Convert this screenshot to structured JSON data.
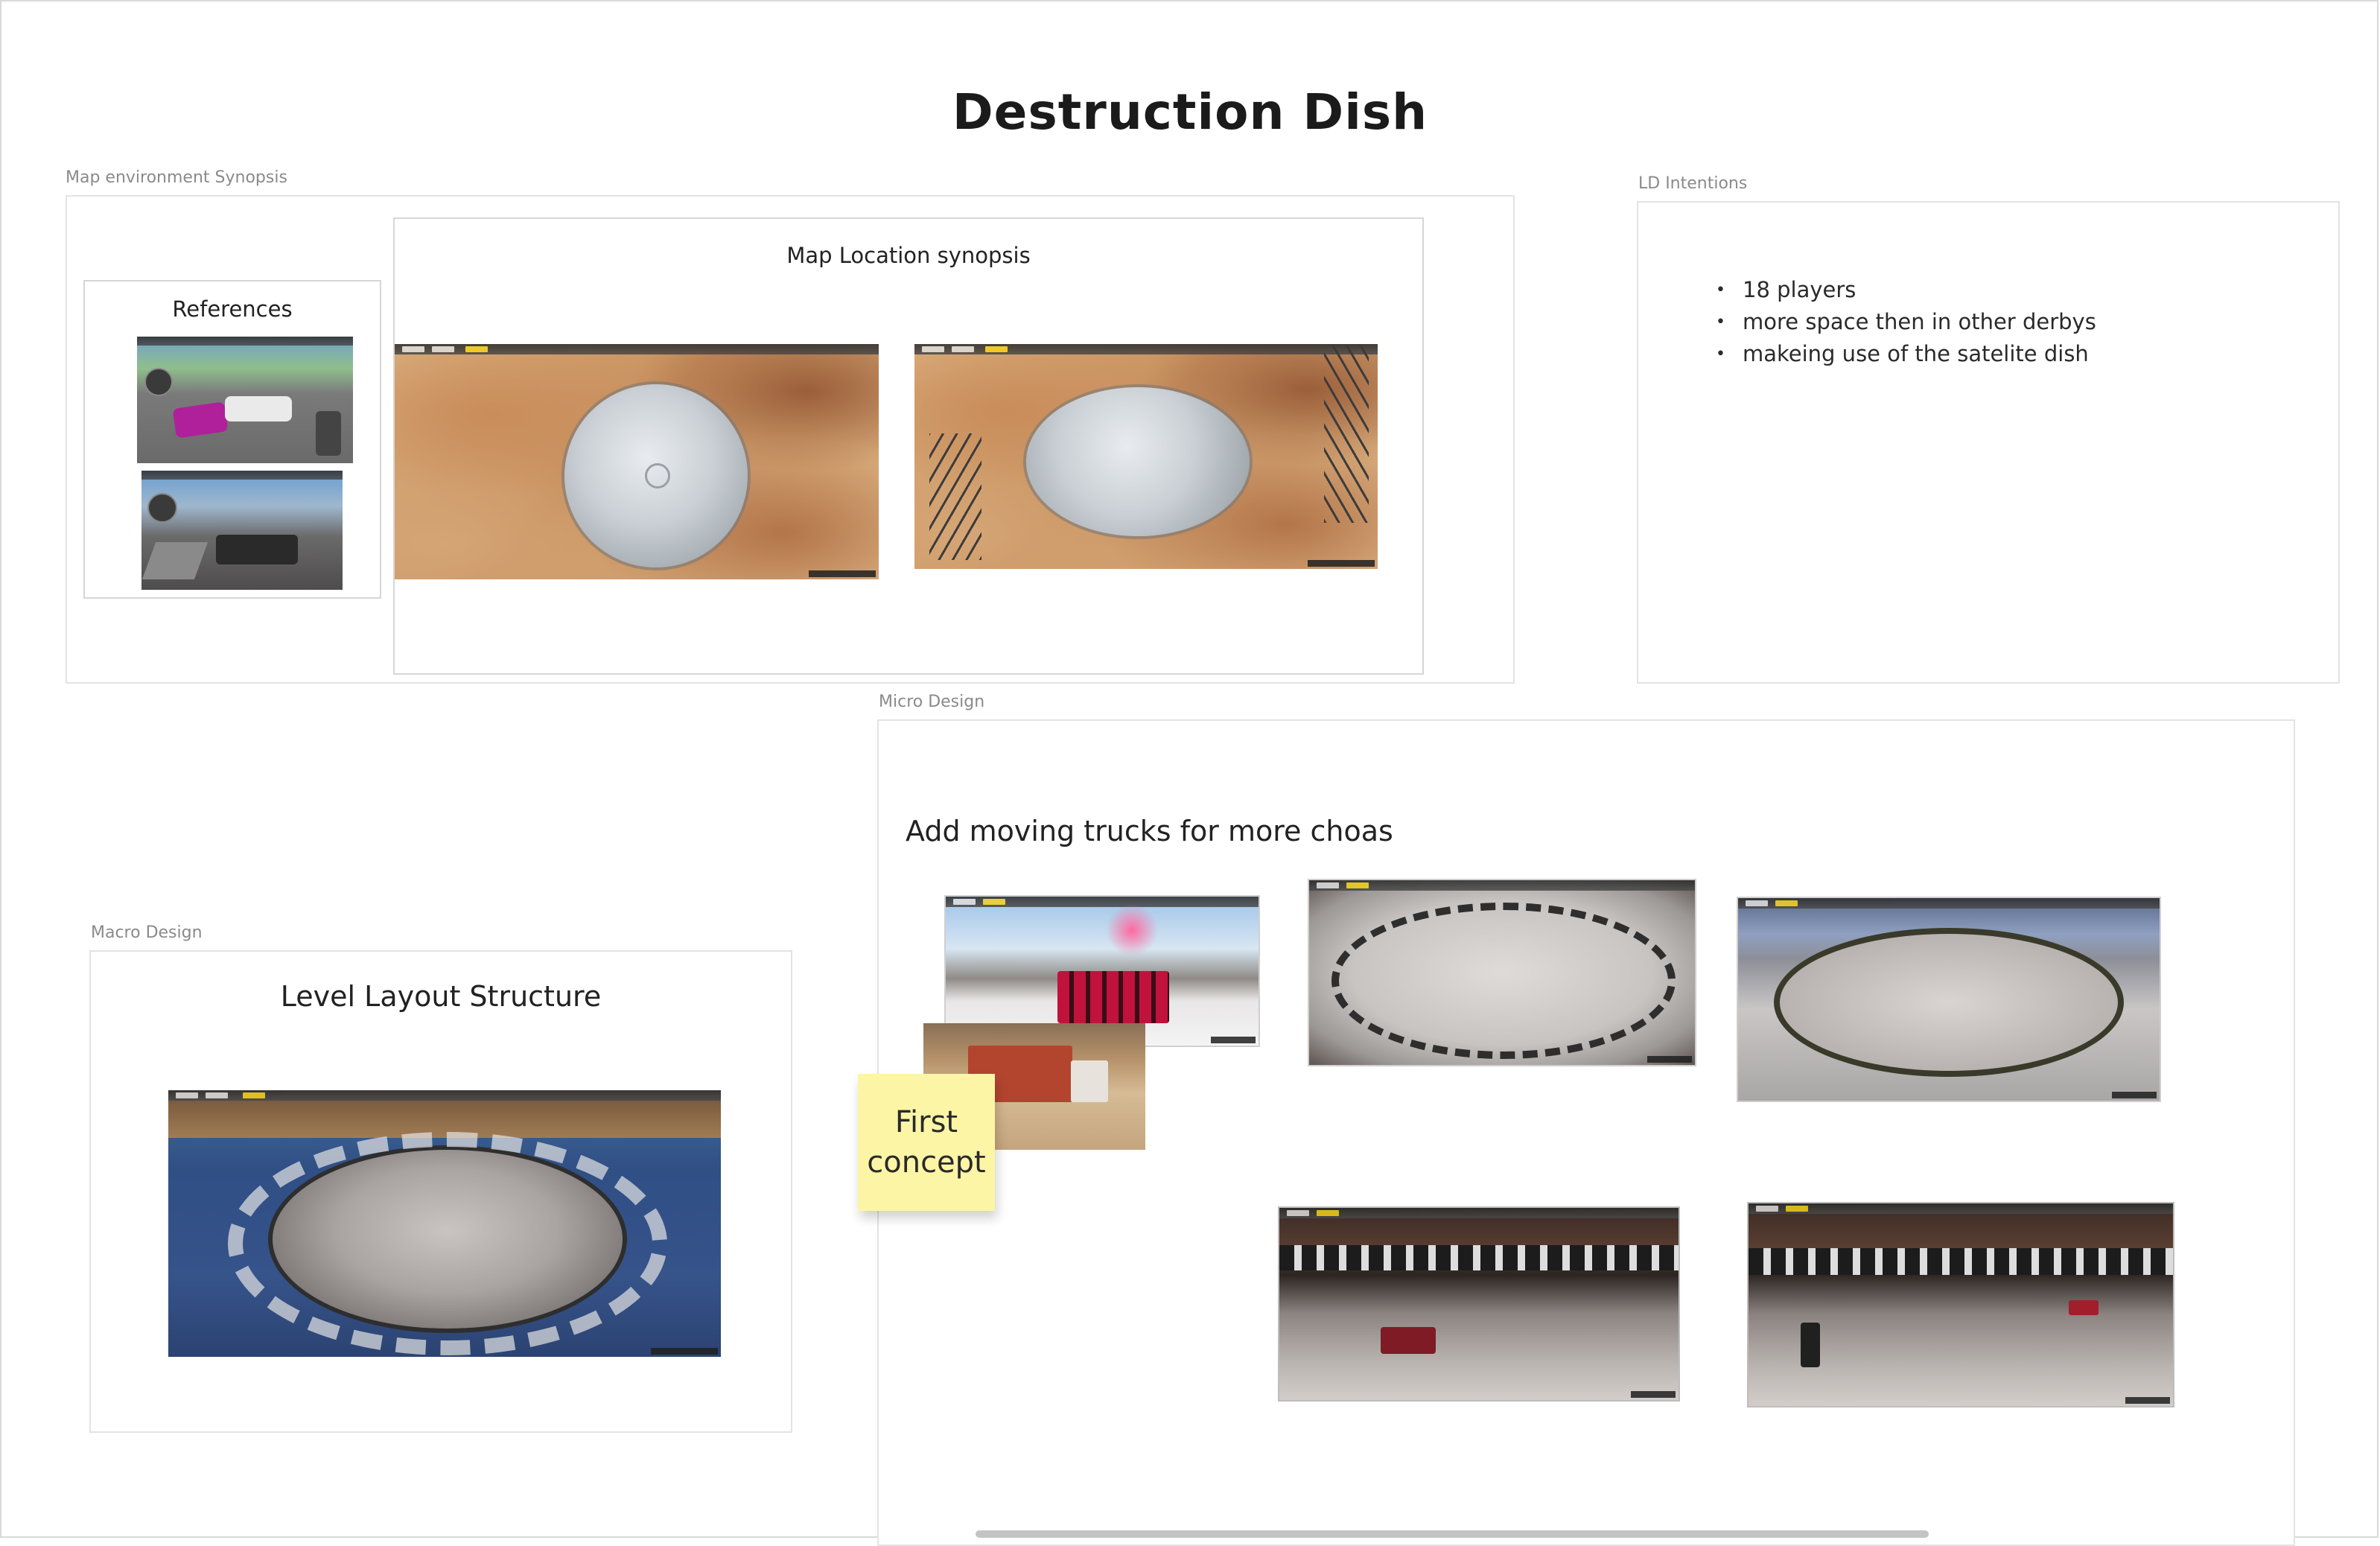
{
  "board": {
    "title": "Destruction Dish"
  },
  "frames": {
    "map_env": {
      "label": "Map environment Synopsis",
      "references_heading": "References",
      "location_heading": "Map Location synopsis"
    },
    "ld": {
      "label": "LD Intentions",
      "bullets": [
        "18 players",
        "more space then in other derbys",
        "makeing use of the satelite dish"
      ]
    },
    "macro": {
      "label": "Macro Design",
      "heading": "Level Layout Structure"
    },
    "micro": {
      "label": "Micro Design",
      "heading": "Add moving trucks for more choas"
    }
  },
  "sticky_note": {
    "text": "First concept",
    "color": "#fdf5a6"
  },
  "colors": {
    "frame_border": "#e3e3e3",
    "label_gray": "#8a8a8a",
    "hud_highlight": "#f3d21b"
  }
}
